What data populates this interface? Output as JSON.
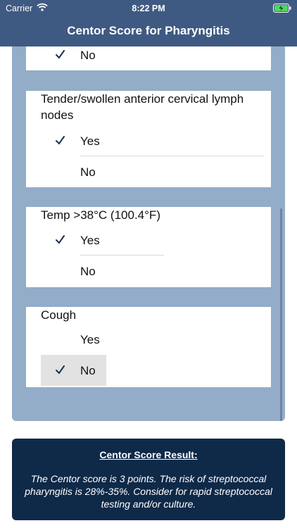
{
  "status_bar": {
    "carrier": "Carrier",
    "time": "8:22 PM"
  },
  "nav": {
    "title": "Centor Score for Pharyngitis"
  },
  "criteria": [
    {
      "question": "",
      "options": [
        {
          "label": "No",
          "selected": true
        }
      ]
    },
    {
      "question": "Tender/swollen anterior cervical lymph nodes",
      "options": [
        {
          "label": "Yes",
          "selected": true
        },
        {
          "label": "No",
          "selected": false
        }
      ]
    },
    {
      "question": "Temp >38°C (100.4°F)",
      "options": [
        {
          "label": "Yes",
          "selected": true
        },
        {
          "label": "No",
          "selected": false
        }
      ]
    },
    {
      "question": "Cough",
      "options": [
        {
          "label": "Yes",
          "selected": false
        },
        {
          "label": "No",
          "selected": true
        }
      ]
    }
  ],
  "result": {
    "title": "Centor Score Result:",
    "text": "The Centor score is 3 points. The risk of streptococcal pharyngitis is 28%-35%. Consider for rapid streptococcal testing and/or culture."
  },
  "colors": {
    "nav_background": "#3f5a82",
    "panel_background": "#93adc8",
    "result_background": "#0f2948",
    "checkmark": "#1c2f52"
  }
}
